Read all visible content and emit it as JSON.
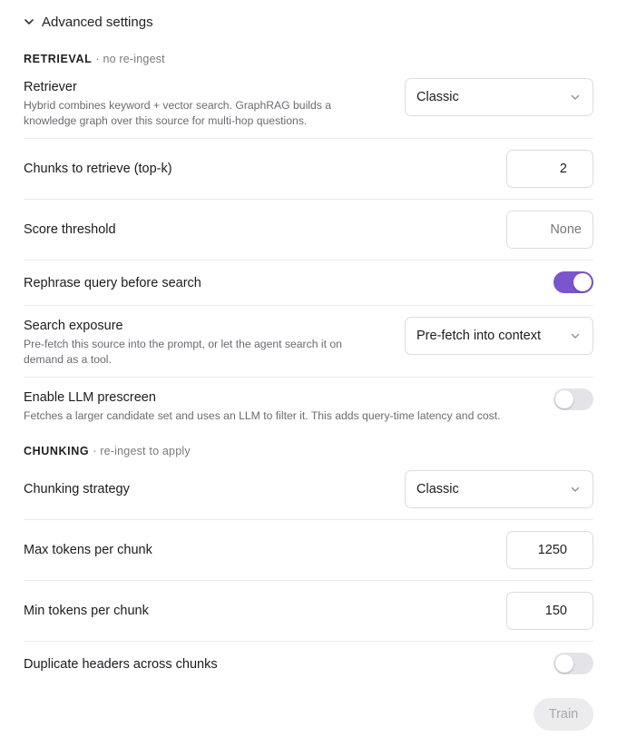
{
  "header": {
    "label": "Advanced settings",
    "icon": "chevron-down-icon"
  },
  "retrieval": {
    "title": "RETRIEVAL",
    "note": "no re-ingest",
    "retriever": {
      "label": "Retriever",
      "description": "Hybrid combines keyword + vector search. GraphRAG builds a knowledge graph over this source for multi-hop questions.",
      "value": "Classic"
    },
    "top_k": {
      "label": "Chunks to retrieve (top-k)",
      "value": "2"
    },
    "score_threshold": {
      "label": "Score threshold",
      "placeholder": "None"
    },
    "rephrase": {
      "label": "Rephrase query before search",
      "enabled": true
    },
    "search_exposure": {
      "label": "Search exposure",
      "description": "Pre-fetch this source into the prompt, or let the agent search it on demand as a tool.",
      "value": "Pre-fetch into context"
    },
    "prescreen": {
      "label": "Enable LLM prescreen",
      "description": "Fetches a larger candidate set and uses an LLM to filter it. This adds query-time latency and cost.",
      "enabled": false
    }
  },
  "chunking": {
    "title": "CHUNKING",
    "note": "re-ingest to apply",
    "strategy": {
      "label": "Chunking strategy",
      "value": "Classic"
    },
    "max_tokens": {
      "label": "Max tokens per chunk",
      "value": "1250"
    },
    "min_tokens": {
      "label": "Min tokens per chunk",
      "value": "150"
    },
    "duplicate_headers": {
      "label": "Duplicate headers across chunks",
      "enabled": false
    }
  },
  "train_button": {
    "label": "Train"
  },
  "colors": {
    "accent": "#7b54cf",
    "toggle_off": "#e4e4e8",
    "muted_text": "#6b6b72",
    "disabled_button": "#ececee"
  }
}
